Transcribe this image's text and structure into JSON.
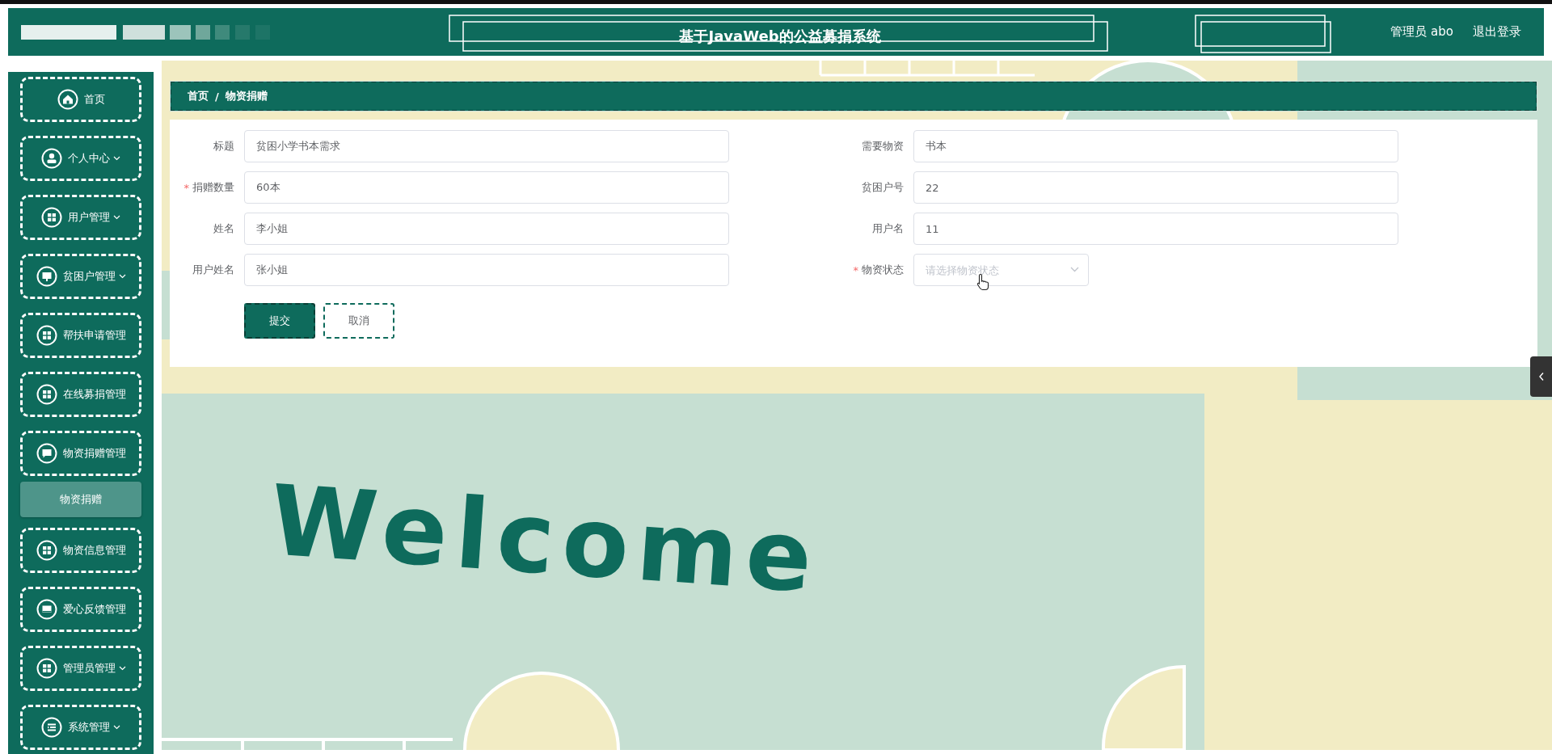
{
  "header": {
    "title": "基于JavaWeb的公益募捐系统",
    "user": "管理员 abo",
    "logout": "退出登录"
  },
  "sidebar": {
    "items": [
      {
        "label": "首页",
        "kind": "home",
        "has_submenu": false
      },
      {
        "label": "个人中心",
        "kind": "user",
        "has_submenu": true
      },
      {
        "label": "用户管理",
        "kind": "grid",
        "has_submenu": true
      },
      {
        "label": "贫困户管理",
        "kind": "monitor",
        "has_submenu": true
      },
      {
        "label": "帮扶申请管理",
        "kind": "grid",
        "has_submenu": false
      },
      {
        "label": "在线募捐管理",
        "kind": "grid",
        "has_submenu": false
      },
      {
        "label": "物资捐赠管理",
        "kind": "chat",
        "has_submenu": false,
        "children": [
          {
            "label": "物资捐赠",
            "selected": true
          }
        ]
      },
      {
        "label": "物资信息管理",
        "kind": "grid",
        "has_submenu": false
      },
      {
        "label": "爱心反馈管理",
        "kind": "card",
        "has_submenu": false
      },
      {
        "label": "管理员管理",
        "kind": "grid",
        "has_submenu": true
      },
      {
        "label": "系统管理",
        "kind": "list",
        "has_submenu": true
      }
    ]
  },
  "required_mark": "*",
  "breadcrumb": {
    "items": [
      "首页",
      "物资捐赠"
    ],
    "separator": "/"
  },
  "form": {
    "fields": [
      {
        "label": "标题",
        "kind": "input",
        "value": "贫困小学书本需求",
        "required": false
      },
      {
        "label": "需要物资",
        "kind": "input",
        "value": "书本",
        "required": false
      },
      {
        "label": "捐赠数量",
        "kind": "input",
        "value": "60本",
        "required": true
      },
      {
        "label": "贫困户号",
        "kind": "input",
        "value": "22",
        "required": false
      },
      {
        "label": "姓名",
        "kind": "input",
        "value": "李小姐",
        "required": false
      },
      {
        "label": "用户名",
        "kind": "input",
        "value": "11",
        "required": false
      },
      {
        "label": "用户姓名",
        "kind": "input",
        "value": "张小姐",
        "required": false
      },
      {
        "label": "物资状态",
        "kind": "select",
        "placeholder": "请选择物资状态",
        "required": true
      }
    ],
    "buttons": [
      {
        "label": "提交",
        "kind": "primary"
      },
      {
        "label": "取消",
        "kind": "plain"
      }
    ]
  },
  "welcome": "Welcome"
}
